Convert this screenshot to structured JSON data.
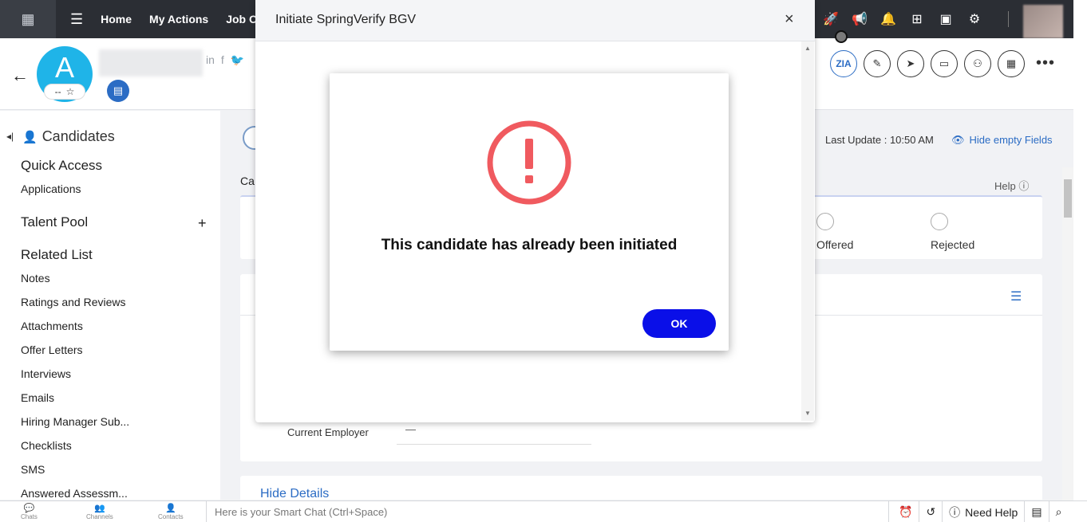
{
  "nav": {
    "links": [
      "Home",
      "My Actions",
      "Job O"
    ]
  },
  "header": {
    "avatar_letter": "A",
    "rating": "--",
    "star": "☆"
  },
  "sidebar": {
    "title": "Candidates",
    "sections": {
      "quick_access": "Quick Access",
      "talent_pool": "Talent Pool",
      "related_list": "Related List"
    },
    "quick_access_items": [
      "Applications"
    ],
    "related_items": [
      "Notes",
      "Ratings and Reviews",
      "Attachments",
      "Offer Letters",
      "Interviews",
      "Emails",
      "Hiring Manager Sub...",
      "Checklists",
      "SMS",
      "Answered Assessm..."
    ]
  },
  "main": {
    "ca_label": "Ca",
    "last_update": "Last Update : 10:50 AM",
    "hide_empty": "Hide empty Fields",
    "help": "Help",
    "stages": [
      "Offered",
      "Rejected"
    ],
    "current_employer_label": "Current Employer",
    "current_employer_value": "—",
    "hide_details": "Hide Details"
  },
  "modal": {
    "title": "Initiate SpringVerify BGV",
    "close": "×"
  },
  "alert": {
    "message": "This candidate has already been initiated",
    "ok_label": "OK",
    "icon_color": "#f05a5f"
  },
  "bottombar": {
    "tabs": [
      "Chats",
      "Channels",
      "Contacts"
    ],
    "smartchat_placeholder": "Here is your Smart Chat (Ctrl+Space)",
    "need_help": "Need Help"
  },
  "colors": {
    "nav_bg": "#2b2e34",
    "accent": "#2b6cc4",
    "ok_button": "#0a0fe8",
    "avatar": "#1fb4e8"
  }
}
